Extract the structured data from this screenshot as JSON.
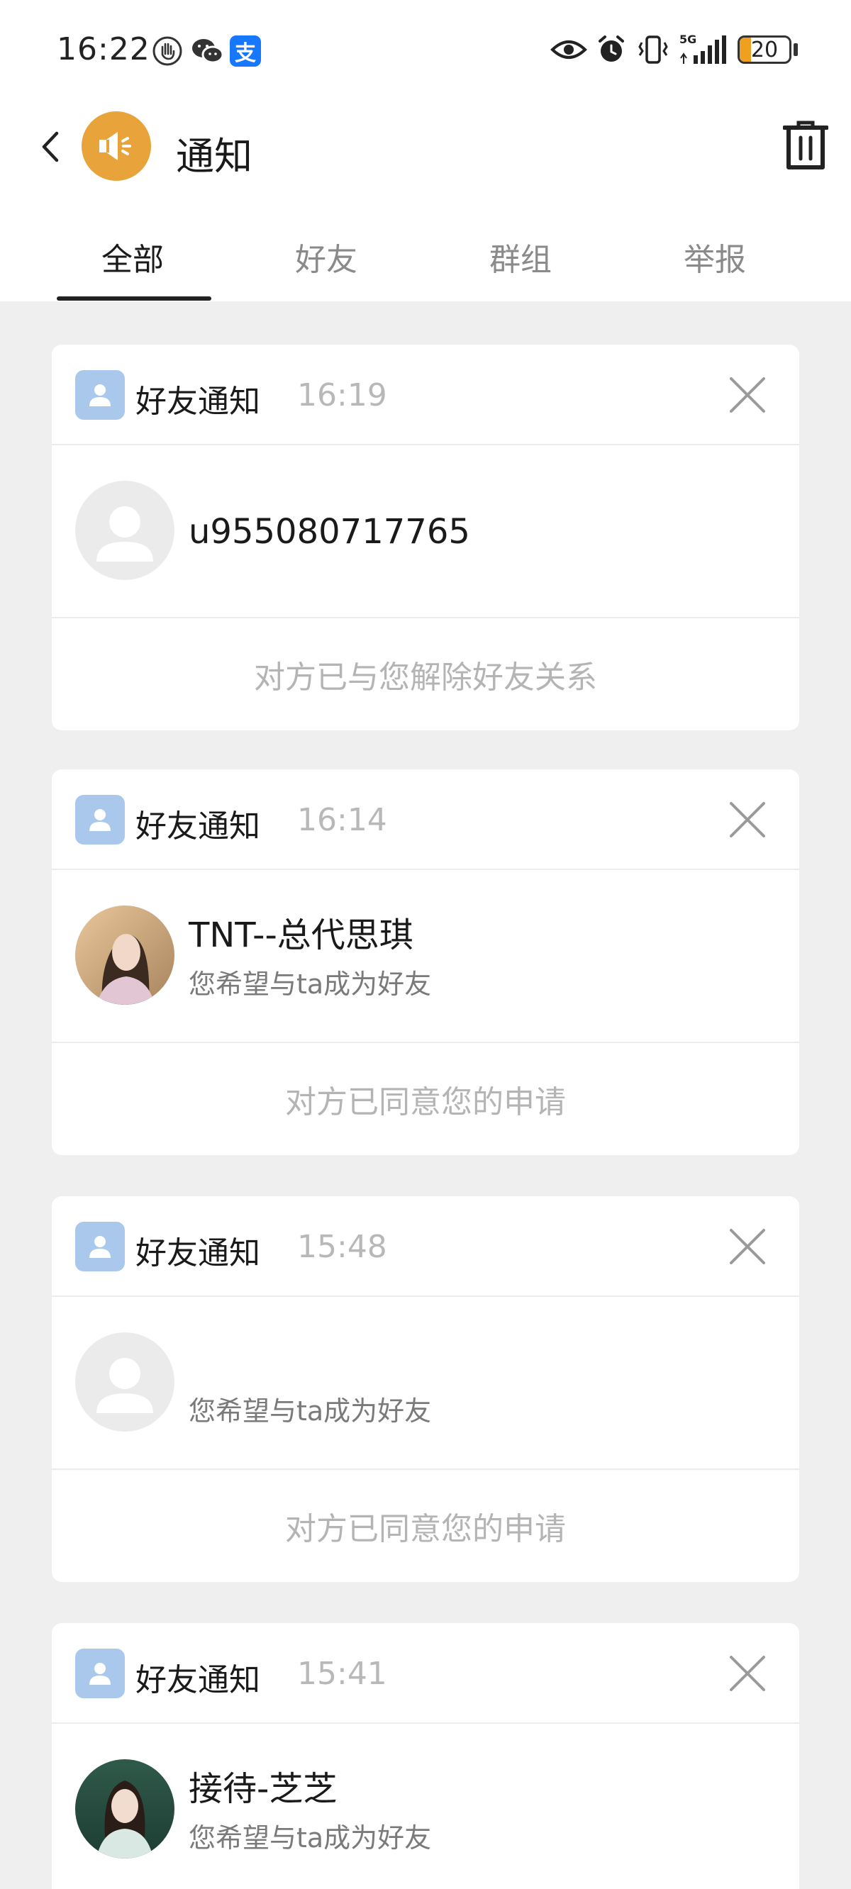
{
  "status_bar": {
    "time": "16:22",
    "left_icons": [
      "hand-icon",
      "wechat-icon",
      "alipay-icon"
    ],
    "alipay_glyph": "支",
    "right_icons": [
      "eye-icon",
      "alarm-icon",
      "vibrate-icon",
      "signal-5g-icon",
      "battery-icon"
    ],
    "network_label": "5G",
    "battery": "20"
  },
  "header": {
    "title": "通知",
    "accent_color": "#e8a33a"
  },
  "tabs": [
    {
      "label": "全部",
      "active": true
    },
    {
      "label": "好友",
      "active": false
    },
    {
      "label": "群组",
      "active": false
    },
    {
      "label": "举报",
      "active": false
    }
  ],
  "notifications": [
    {
      "type": "好友通知",
      "time": "16:19",
      "user_name": "u955080717765",
      "subtitle": "",
      "avatar": "default-avatar",
      "result": "对方已与您解除好友关系"
    },
    {
      "type": "好友通知",
      "time": "16:14",
      "user_name": "TNT--总代思琪",
      "subtitle": "您希望与ta成为好友",
      "avatar": "photo-avatar",
      "result": "对方已同意您的申请"
    },
    {
      "type": "好友通知",
      "time": "15:48",
      "user_name": "",
      "subtitle": "您希望与ta成为好友",
      "avatar": "default-avatar",
      "result": "对方已同意您的申请"
    },
    {
      "type": "好友通知",
      "time": "15:41",
      "user_name": "接待-芝芝",
      "subtitle": "您希望与ta成为好友",
      "avatar": "photo-avatar",
      "result": ""
    }
  ]
}
